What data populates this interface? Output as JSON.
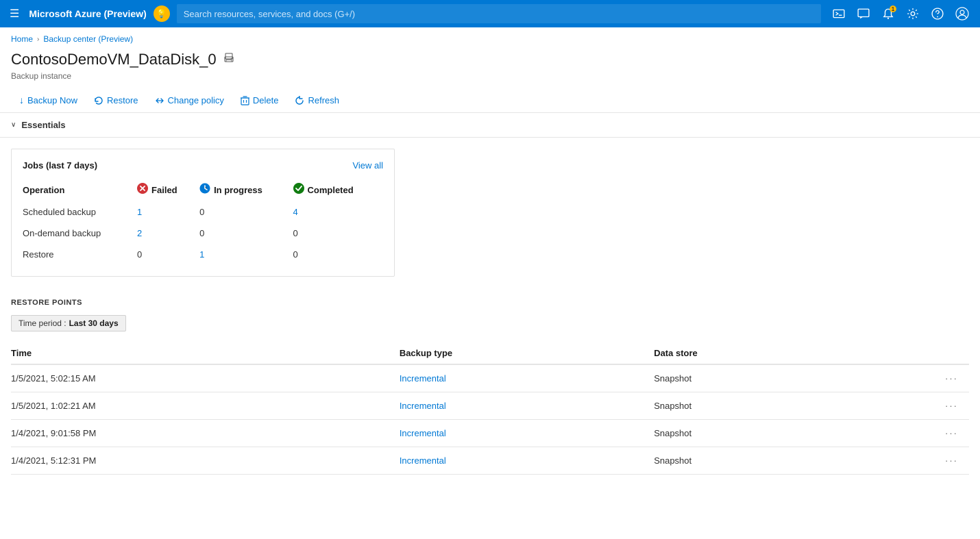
{
  "topbar": {
    "menu_icon": "☰",
    "title": "Microsoft Azure (Preview)",
    "lightbulb": "💡",
    "search_placeholder": "Search resources, services, and docs (G+/)",
    "icons": [
      {
        "name": "cloud-shell-icon",
        "glyph": "⬛",
        "label": "Cloud Shell"
      },
      {
        "name": "feedback-icon",
        "glyph": "💬",
        "label": "Feedback"
      },
      {
        "name": "notifications-icon",
        "glyph": "🔔",
        "label": "Notifications",
        "badge": "1"
      },
      {
        "name": "settings-icon",
        "glyph": "⚙",
        "label": "Settings"
      },
      {
        "name": "help-icon",
        "glyph": "?",
        "label": "Help"
      },
      {
        "name": "account-icon",
        "glyph": "😊",
        "label": "Account"
      }
    ]
  },
  "breadcrumb": {
    "items": [
      "Home",
      "Backup center (Preview)"
    ]
  },
  "page": {
    "title": "ContosoDemoVM_DataDisk_0",
    "subtitle": "Backup instance"
  },
  "toolbar": {
    "buttons": [
      {
        "name": "backup-now-button",
        "icon": "↓",
        "label": "Backup Now"
      },
      {
        "name": "restore-button",
        "icon": "↩",
        "label": "Restore"
      },
      {
        "name": "change-policy-button",
        "icon": "⇄",
        "label": "Change policy"
      },
      {
        "name": "delete-button",
        "icon": "🗑",
        "label": "Delete"
      },
      {
        "name": "refresh-button",
        "icon": "↺",
        "label": "Refresh"
      }
    ]
  },
  "essentials": {
    "label": "Essentials",
    "chevron": "∨"
  },
  "jobs_card": {
    "title": "Jobs (last 7 days)",
    "view_all": "View all",
    "columns": [
      "Operation",
      "Failed",
      "In progress",
      "Completed"
    ],
    "status_icons": {
      "failed": "✖",
      "inprogress": "🔄",
      "completed": "✔"
    },
    "rows": [
      {
        "operation": "Scheduled backup",
        "failed": "1",
        "failed_link": true,
        "in_progress": "0",
        "in_progress_link": false,
        "completed": "4",
        "completed_link": true
      },
      {
        "operation": "On-demand backup",
        "failed": "2",
        "failed_link": true,
        "in_progress": "0",
        "in_progress_link": false,
        "completed": "0",
        "completed_link": false
      },
      {
        "operation": "Restore",
        "failed": "0",
        "failed_link": false,
        "in_progress": "1",
        "in_progress_link": true,
        "completed": "0",
        "completed_link": false
      }
    ]
  },
  "restore_points": {
    "section_title": "RESTORE POINTS",
    "time_period_label": "Time period :",
    "time_period_value": "Last 30 days",
    "columns": [
      "Time",
      "Backup type",
      "Data store",
      ""
    ],
    "rows": [
      {
        "time": "1/5/2021, 5:02:15 AM",
        "backup_type": "Incremental",
        "data_store": "Snapshot"
      },
      {
        "time": "1/5/2021, 1:02:21 AM",
        "backup_type": "Incremental",
        "data_store": "Snapshot"
      },
      {
        "time": "1/4/2021, 9:01:58 PM",
        "backup_type": "Incremental",
        "data_store": "Snapshot"
      },
      {
        "time": "1/4/2021, 5:12:31 PM",
        "backup_type": "Incremental",
        "data_store": "Snapshot"
      }
    ],
    "ellipsis": "···"
  }
}
